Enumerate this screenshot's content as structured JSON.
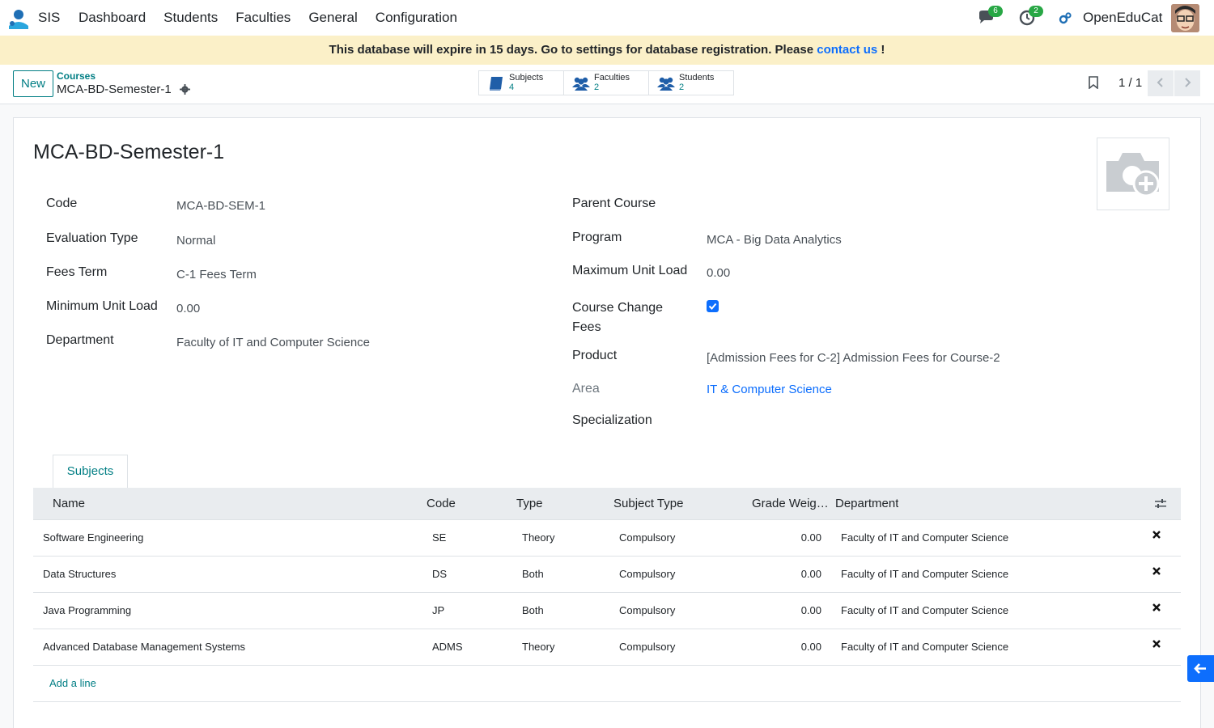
{
  "navbar": {
    "app_name": "SIS",
    "menu": [
      "Dashboard",
      "Students",
      "Faculties",
      "General",
      "Configuration"
    ],
    "messages_count": "6",
    "activities_count": "2",
    "company": "OpenEduCat"
  },
  "banner": {
    "text": "This database will expire in 15 days. Go to settings for database registration. Please ",
    "link": "contact us",
    "suffix": " !"
  },
  "control_panel": {
    "new_label": "New",
    "breadcrumb_parent": "Courses",
    "breadcrumb_current": "MCA-BD-Semester-1",
    "smart_buttons": [
      {
        "label": "Subjects",
        "count": "4"
      },
      {
        "label": "Faculties",
        "count": "2"
      },
      {
        "label": "Students",
        "count": "2"
      }
    ],
    "pager": "1 / 1"
  },
  "form": {
    "title": "MCA-BD-Semester-1",
    "left_fields": [
      {
        "label": "Code",
        "value": "MCA-BD-SEM-1"
      },
      {
        "label": "Evaluation Type",
        "value": "Normal"
      },
      {
        "label": "Fees Term",
        "value": "C-1 Fees Term"
      },
      {
        "label": "Minimum Unit Load",
        "value": "0.00"
      },
      {
        "label": "Department",
        "value": "Faculty of IT and Computer Science"
      }
    ],
    "right_fields": [
      {
        "label": "Parent Course",
        "value": ""
      },
      {
        "label": "Program",
        "value": "MCA - Big Data Analytics"
      },
      {
        "label": "Maximum Unit Load",
        "value": "0.00"
      },
      {
        "label": "Course Change Fees",
        "value": "checked"
      },
      {
        "label": "Product",
        "value": "[Admission Fees for C-2] Admission Fees for Course-2"
      },
      {
        "label": "Area",
        "value": "IT & Computer Science"
      },
      {
        "label": "Specialization",
        "value": ""
      }
    ]
  },
  "tabs": [
    "Subjects"
  ],
  "table": {
    "headers": [
      "Name",
      "Code",
      "Type",
      "Subject Type",
      "Grade Weig…",
      "Department"
    ],
    "rows": [
      [
        "Software Engineering",
        "SE",
        "Theory",
        "Compulsory",
        "0.00",
        "Faculty of IT and Computer Science"
      ],
      [
        "Data Structures",
        "DS",
        "Both",
        "Compulsory",
        "0.00",
        "Faculty of IT and Computer Science"
      ],
      [
        "Java Programming",
        "JP",
        "Both",
        "Compulsory",
        "0.00",
        "Faculty of IT and Computer Science"
      ],
      [
        "Advanced Database Management Systems",
        "ADMS",
        "Theory",
        "Compulsory",
        "0.00",
        "Faculty of IT and Computer Science"
      ]
    ],
    "add_line": "Add a line"
  }
}
